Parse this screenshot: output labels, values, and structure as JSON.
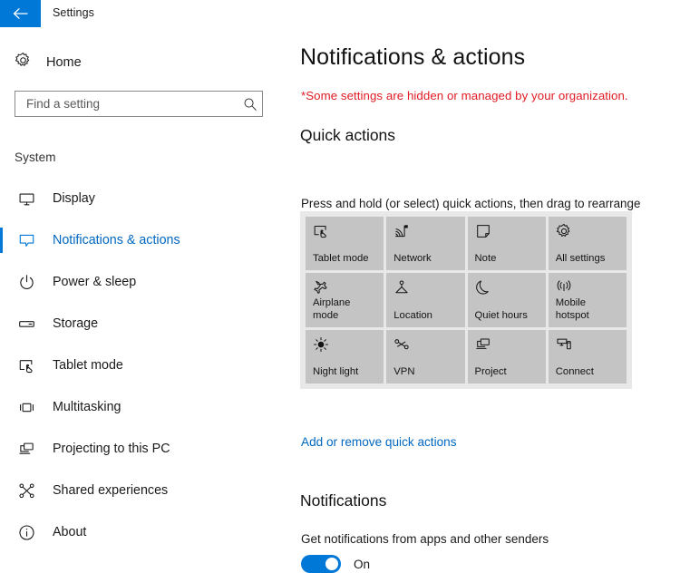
{
  "titlebar": {
    "back_icon": "back-arrow-icon",
    "app_title": "Settings",
    "accent_color": "#0078d7"
  },
  "sidebar": {
    "home": {
      "label": "Home",
      "icon": "gear-icon"
    },
    "search": {
      "placeholder": "Find a setting",
      "value": "",
      "icon": "search-icon"
    },
    "group_title": "System",
    "items": [
      {
        "label": "Display",
        "icon": "monitor-icon",
        "selected": false
      },
      {
        "label": "Notifications & actions",
        "icon": "speech-bubble-icon",
        "selected": true
      },
      {
        "label": "Power & sleep",
        "icon": "power-icon",
        "selected": false
      },
      {
        "label": "Storage",
        "icon": "drive-icon",
        "selected": false
      },
      {
        "label": "Tablet mode",
        "icon": "tablet-hand-icon",
        "selected": false
      },
      {
        "label": "Multitasking",
        "icon": "windows-layout-icon",
        "selected": false
      },
      {
        "label": "Projecting to this PC",
        "icon": "project-screens-icon",
        "selected": false
      },
      {
        "label": "Shared experiences",
        "icon": "share-nodes-icon",
        "selected": false
      },
      {
        "label": "About",
        "icon": "info-circle-icon",
        "selected": false
      }
    ],
    "selected_color": "#0067c0"
  },
  "main": {
    "page_title": "Notifications & actions",
    "org_warning": "*Some settings are hidden or managed by your organization.",
    "org_warning_color": "#e01b24",
    "quick_actions": {
      "heading": "Quick actions",
      "description": "Press and hold (or select) quick actions, then drag to rearrange them. These quick actions appear in action center.",
      "tiles": [
        {
          "label": "Tablet mode",
          "icon": "tablet-hand-icon"
        },
        {
          "label": "Network",
          "icon": "wifi-icon"
        },
        {
          "label": "Note",
          "icon": "note-icon"
        },
        {
          "label": "All settings",
          "icon": "gear-icon"
        },
        {
          "label": "Airplane mode",
          "icon": "airplane-icon"
        },
        {
          "label": "Location",
          "icon": "location-pin-icon"
        },
        {
          "label": "Quiet hours",
          "icon": "moon-icon"
        },
        {
          "label": "Mobile hotspot",
          "icon": "broadcast-icon"
        },
        {
          "label": "Night light",
          "icon": "brightness-sun-icon"
        },
        {
          "label": "VPN",
          "icon": "vpn-key-icon"
        },
        {
          "label": "Project",
          "icon": "project-screens-icon"
        },
        {
          "label": "Connect",
          "icon": "connect-device-icon"
        }
      ],
      "add_remove_link": "Add or remove quick actions"
    },
    "notifications": {
      "heading": "Notifications",
      "toggle_label": "Get notifications from apps and other senders",
      "toggle_state": "On",
      "toggle_on": true,
      "toggle_color": "#0078d7"
    }
  }
}
